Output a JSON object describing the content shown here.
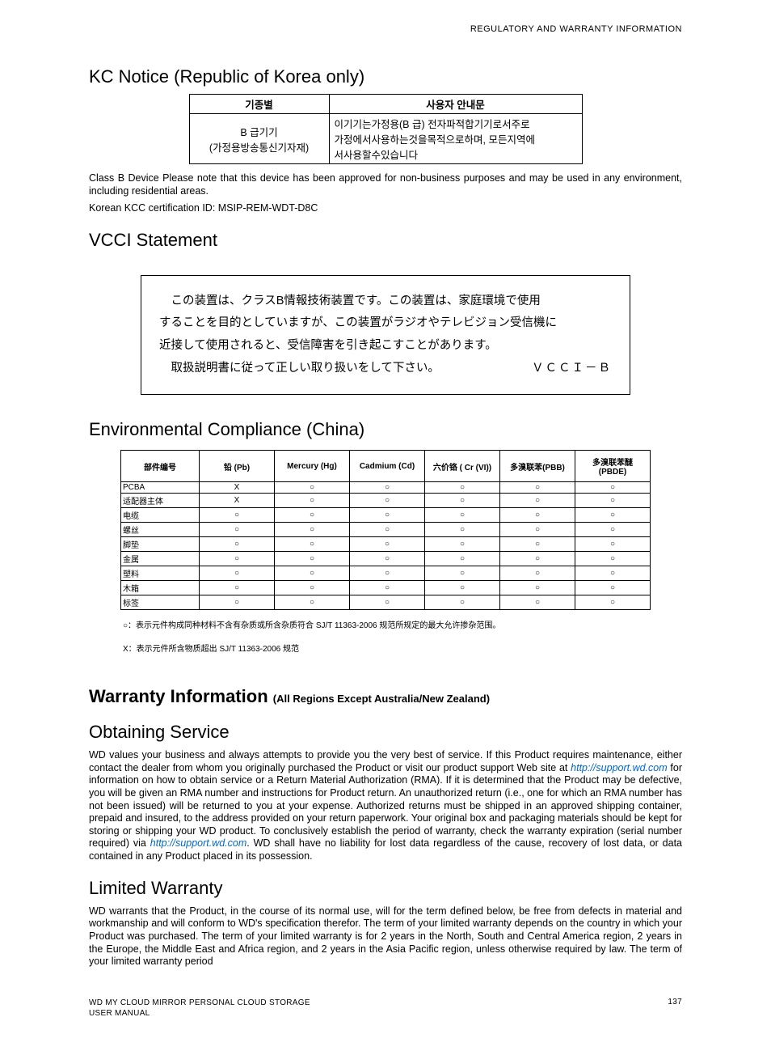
{
  "header": {
    "right": "REGULATORY AND WARRANTY INFORMATION"
  },
  "kc": {
    "heading": "KC Notice (Republic of Korea only)",
    "table": {
      "h1": "기종별",
      "h2": "사용자 안내문",
      "c1a": "B 급기기",
      "c1b": "(가정용방송통신기자재)",
      "c2a": "이기기는가정용(B 급) 전자파적합기기로서주로",
      "c2b": "가정에서사용하는것을목적으로하며, 모든지역에",
      "c2c": "서사용할수있습니다"
    },
    "p1": "Class B Device Please note that this device has been approved for non-business purposes and may be used in any environment, including residential areas.",
    "p2": "Korean KCC certification ID: MSIP-REM-WDT-D8C"
  },
  "vcci": {
    "heading": "VCCI Statement",
    "l1": "この装置は、クラスB情報技術装置です。この装置は、家庭環境で使用",
    "l2": "することを目的としていますが、この装置がラジオやテレビジョン受信機に",
    "l3": "近接して使用されると、受信障害を引き起こすことがあります。",
    "l4": "取扱説明書に従って正しい取り扱いをして下さい。",
    "badge": "ＶＣＣＩ－Ｂ"
  },
  "env": {
    "heading": "Environmental Compliance (China)",
    "headers": [
      "部件编号",
      "铅 (Pb)",
      "Mercury (Hg)",
      "Cadmium (Cd)",
      "六价铬 ( Cr (VI))",
      "多溴联苯(PBB)",
      "多溴联苯醚(PBDE)"
    ],
    "rows": [
      {
        "name": "PCBA",
        "v": [
          "X",
          "○",
          "○",
          "○",
          "○",
          "○"
        ]
      },
      {
        "name": "适配器主体",
        "v": [
          "X",
          "○",
          "○",
          "○",
          "○",
          "○"
        ]
      },
      {
        "name": "电缆",
        "v": [
          "○",
          "○",
          "○",
          "○",
          "○",
          "○"
        ]
      },
      {
        "name": "螺丝",
        "v": [
          "○",
          "○",
          "○",
          "○",
          "○",
          "○"
        ]
      },
      {
        "name": "脚垫",
        "v": [
          "○",
          "○",
          "○",
          "○",
          "○",
          "○"
        ]
      },
      {
        "name": "金属",
        "v": [
          "○",
          "○",
          "○",
          "○",
          "○",
          "○"
        ]
      },
      {
        "name": "塑料",
        "v": [
          "○",
          "○",
          "○",
          "○",
          "○",
          "○"
        ]
      },
      {
        "name": "木箱",
        "v": [
          "○",
          "○",
          "○",
          "○",
          "○",
          "○"
        ]
      },
      {
        "name": "标签",
        "v": [
          "○",
          "○",
          "○",
          "○",
          "○",
          "○"
        ]
      }
    ],
    "note1": "○：表示元件构成同种材料不含有杂质或所含杂质符合 SJ/T 11363-2006 规范所规定的最大允许掺杂范围。",
    "note2": "X：表示元件所含物质超出 SJ/T 11363-2006 规范"
  },
  "warranty": {
    "heading": "Warranty Information",
    "sub": "(All Regions Except Australia/New Zealand)"
  },
  "obtain": {
    "heading": "Obtaining Service",
    "p_a": "WD values your business and always attempts to provide you the very best of service. If this Product requires maintenance, either contact the dealer from whom you originally purchased the Product or visit our product support Web site at ",
    "link1": "http://support.wd.com",
    "p_b": " for information on how to obtain service or a Return Material Authorization (RMA). If it is determined that the Product may be defective, you will be given an RMA number and instructions for Product return. An unauthorized return (i.e., one for which an RMA number has not been issued) will be returned to you at your expense. Authorized returns must be shipped in an approved shipping container, prepaid and insured, to the address provided on your return paperwork. Your original box and packaging materials should be kept for storing or shipping your WD product. To conclusively establish the period of warranty, check the warranty expiration (serial number required) via ",
    "link2": "http://support.wd.com",
    "p_c": ". WD shall have no liability for lost data regardless of the cause, recovery of lost data, or data contained in any Product placed in its possession."
  },
  "limited": {
    "heading": "Limited Warranty",
    "p": "WD warrants that the Product, in the course of its normal use, will for the term defined below, be free from defects in material and workmanship and will conform to WD's specification therefor. The term of your limited warranty depends on the country in which your Product was purchased. The term of your limited warranty is for 2 years in the North, South and Central America region, 2 years in the Europe, the Middle East and Africa region, and 2 years in the Asia Pacific region, unless otherwise required by law. The term of your limited warranty period"
  },
  "footer": {
    "l1": "WD MY CLOUD MIRROR PERSONAL CLOUD STORAGE",
    "l2": "USER MANUAL",
    "page": "137"
  }
}
